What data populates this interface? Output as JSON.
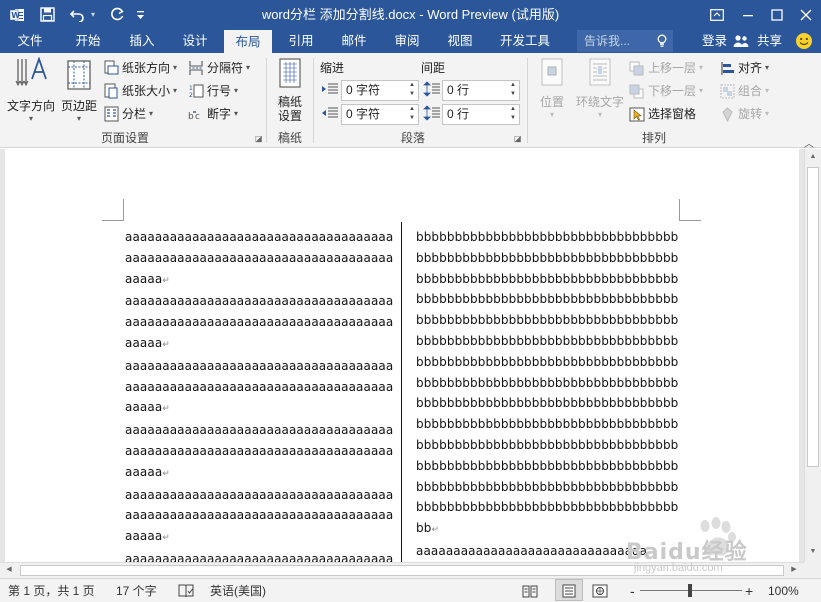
{
  "app": {
    "title": "word分栏 添加分割线.docx - Word Preview (试用版)",
    "word_logo": "W"
  },
  "quick_access": {
    "icons": [
      "word-app-icon",
      "save-icon",
      "undo-icon",
      "redo-icon",
      "customize-icon"
    ]
  },
  "window_controls": {
    "icons": [
      "ribbon-display-icon",
      "minimize-icon",
      "maximize-icon",
      "close-icon"
    ]
  },
  "tabs": [
    {
      "label": "文件",
      "active": false
    },
    {
      "label": "开始",
      "active": false
    },
    {
      "label": "插入",
      "active": false
    },
    {
      "label": "设计",
      "active": false
    },
    {
      "label": "布局",
      "active": true
    },
    {
      "label": "引用",
      "active": false
    },
    {
      "label": "邮件",
      "active": false
    },
    {
      "label": "审阅",
      "active": false
    },
    {
      "label": "视图",
      "active": false
    },
    {
      "label": "开发工具",
      "active": false
    }
  ],
  "tell_me": {
    "placeholder": "告诉我..."
  },
  "account": {
    "login": "登录",
    "share": "共享"
  },
  "ribbon": {
    "page_setup": {
      "label": "页面设置",
      "text_direction": "文字方向",
      "margins": "页边距",
      "orientation": "纸张方向",
      "size": "纸张大小",
      "columns": "分栏",
      "breaks": "分隔符",
      "line_numbers": "行号",
      "hyphenation": "断字"
    },
    "manuscript": {
      "label": "稿纸",
      "button_line1": "稿纸",
      "button_line2": "设置"
    },
    "paragraph": {
      "label": "段落",
      "indent_label": "缩进",
      "spacing_label": "间距",
      "indent_left": "0 字符",
      "indent_right": "0 字符",
      "spacing_before": "0 行",
      "spacing_after": "0 行"
    },
    "arrange": {
      "label": "排列",
      "position": "位置",
      "wrap_text": "环绕文字",
      "bring_forward": "上移一层",
      "send_backward": "下移一层",
      "selection_pane": "选择窗格",
      "align": "对齐",
      "group": "组合",
      "rotate": "旋转"
    }
  },
  "document": {
    "left_column_lines": [
      "aaaaaaaaaaaaaaaaaaaaaaaaaaaaaaaaaaaa",
      "aaaaaaaaaaaaaaaaaaaaaaaaaaaaaaaaaaaa",
      "aaaaa",
      "aaaaaaaaaaaaaaaaaaaaaaaaaaaaaaaaaaaa",
      "aaaaaaaaaaaaaaaaaaaaaaaaaaaaaaaaaaaa",
      "aaaaa",
      "aaaaaaaaaaaaaaaaaaaaaaaaaaaaaaaaaaaa",
      "aaaaaaaaaaaaaaaaaaaaaaaaaaaaaaaaaaaa",
      "aaaaa",
      "aaaaaaaaaaaaaaaaaaaaaaaaaaaaaaaaaaaa",
      "aaaaaaaaaaaaaaaaaaaaaaaaaaaaaaaaaaaa",
      "aaaaa",
      "aaaaaaaaaaaaaaaaaaaaaaaaaaaaaaaaaaaa",
      "aaaaaaaaaaaaaaaaaaaaaaaaaaaaaaaaaaaa",
      "aaaaa",
      "aaaaaaaaaaaaaaaaaaaaaaaaaaaaaaaaaaaa"
    ],
    "left_paragraph_mark_lines": [
      2,
      5,
      8,
      11,
      14
    ],
    "right_column_lines": [
      "bbbbbbbbbbbbbbbbbbbbbbbbbbbbbbbbbb",
      "bbbbbbbbbbbbbbbbbbbbbbbbbbbbbbbbbb",
      "bbbbbbbbbbbbbbbbbbbbbbbbbbbbbbbbbb",
      "bbbbbbbbbbbbbbbbbbbbbbbbbbbbbbbbbb",
      "bbbbbbbbbbbbbbbbbbbbbbbbbbbbbbbbbb",
      "bbbbbbbbbbbbbbbbbbbbbbbbbbbbbbbbbb",
      "bbbbbbbbbbbbbbbbbbbbbbbbbbbbbbbbbb",
      "bbbbbbbbbbbbbbbbbbbbbbbbbbbbbbbbbb",
      "bbbbbbbbbbbbbbbbbbbbbbbbbbbbbbbbbb",
      "bbbbbbbbbbbbbbbbbbbbbbbbbbbbbbbbbb",
      "bbbbbbbbbbbbbbbbbbbbbbbbbbbbbbbbbb",
      "bbbbbbbbbbbbbbbbbbbbbbbbbbbbbbbbbb",
      "bbbbbbbbbbbbbbbbbbbbbbbbbbbbbbbbbb",
      "bbbbbbbbbbbbbbbbbbbbbbbbbbbbbbbbbb",
      "bb",
      "aaaaaaaaaaaaaaaaaaaaaaaaaaaaaaa"
    ],
    "right_paragraph_mark_lines": [
      14
    ],
    "paragraph_mark": "↵"
  },
  "status": {
    "page": "第 1 页，共 1 页",
    "words": "17 个字",
    "language": "英语(美国)",
    "zoom": "100%",
    "zoom_minus": "-",
    "zoom_plus": "+",
    "zoom_level": 100
  },
  "watermark": {
    "brand": "Baidu经验",
    "url": "jingyan.baidu.com"
  },
  "colors": {
    "accent": "#2b579a",
    "ribbon_bg": "#f3f3f3",
    "doc_bg": "#e6e6e6"
  }
}
